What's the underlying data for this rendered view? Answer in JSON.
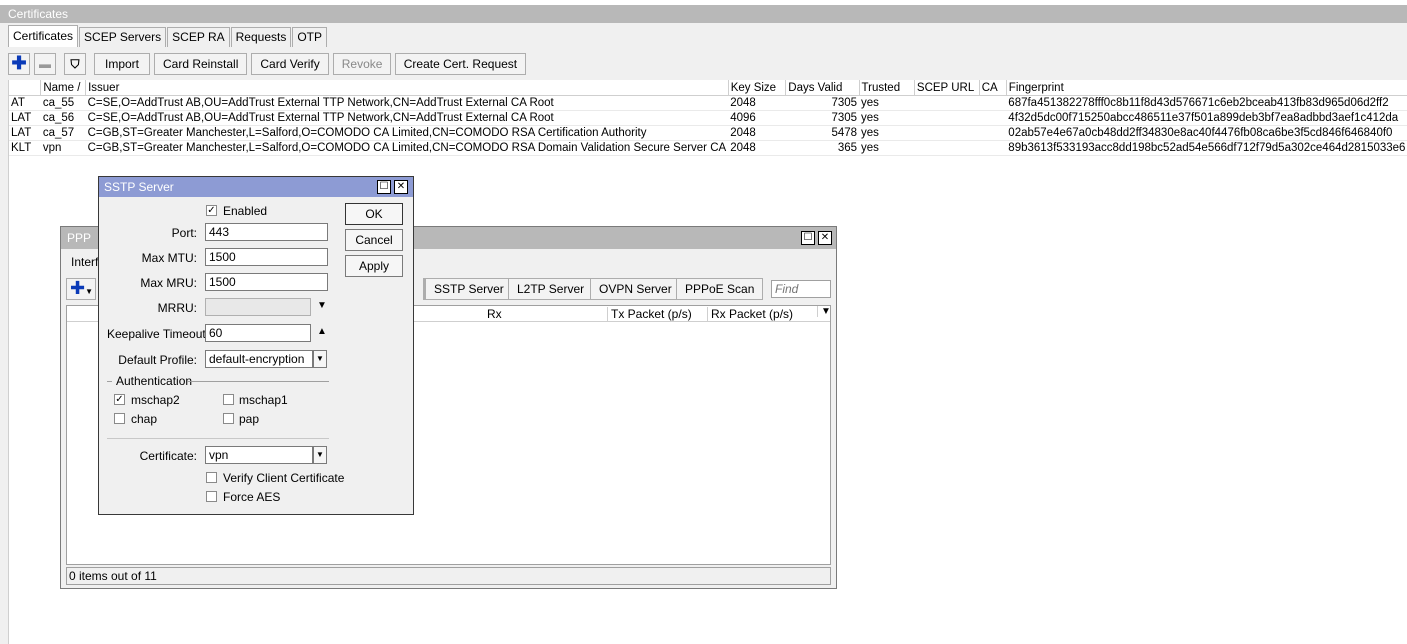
{
  "cert_window": {
    "title": "Certificates",
    "tabs": [
      "Certificates",
      "SCEP Servers",
      "SCEP RA",
      "Requests",
      "OTP"
    ],
    "toolbar": {
      "import": "Import",
      "card_reinstall": "Card Reinstall",
      "card_verify": "Card Verify",
      "revoke": "Revoke",
      "create_request": "Create Cert. Request"
    },
    "columns": [
      "",
      "Name",
      "Issuer",
      "Key Size",
      "Days Valid",
      "Trusted",
      "SCEP URL",
      "CA",
      "Fingerprint"
    ],
    "rows": [
      {
        "flags": "AT",
        "name": "ca_55",
        "issuer": "C=SE,O=AddTrust AB,OU=AddTrust External TTP Network,CN=AddTrust External CA Root",
        "key_size": "2048",
        "days": "7305",
        "trusted": "yes",
        "fingerprint": "687fa451382278fff0c8b11f8d43d576671c6eb2bceab413fb83d965d06d2ff2"
      },
      {
        "flags": "LAT",
        "name": "ca_56",
        "issuer": "C=SE,O=AddTrust AB,OU=AddTrust External TTP Network,CN=AddTrust External CA Root",
        "key_size": "4096",
        "days": "7305",
        "trusted": "yes",
        "fingerprint": "4f32d5dc00f715250abcc486511e37f501a899deb3bf7ea8adbbd3aef1c412da"
      },
      {
        "flags": "LAT",
        "name": "ca_57",
        "issuer": "C=GB,ST=Greater Manchester,L=Salford,O=COMODO CA Limited,CN=COMODO RSA Certification Authority",
        "key_size": "2048",
        "days": "5478",
        "trusted": "yes",
        "fingerprint": "02ab57e4e67a0cb48dd2ff34830e8ac40f4476fb08ca6be3f5cd846f646840f0"
      },
      {
        "flags": "KLT",
        "name": "vpn",
        "issuer": "C=GB,ST=Greater Manchester,L=Salford,O=COMODO CA Limited,CN=COMODO RSA Domain Validation Secure Server CA",
        "key_size": "2048",
        "days": "365",
        "trusted": "yes",
        "fingerprint": "89b3613f533193acc8dd198bc52ad54e566df712f79d5a302ce464d2815033e6"
      }
    ]
  },
  "ppp_window": {
    "title": "PPP",
    "tab_partial": "Interfa",
    "buttons": {
      "sstp": "SSTP Server",
      "l2tp": "L2TP Server",
      "ovpn": "OVPN Server",
      "pppoe_scan": "PPPoE Scan"
    },
    "find_placeholder": "Find",
    "columns": [
      "Rx",
      "Tx Packet (p/s)",
      "Rx Packet (p/s)"
    ],
    "status": "0 items out of 11"
  },
  "sstp_dialog": {
    "title": "SSTP Server",
    "enabled_label": "Enabled",
    "port_label": "Port:",
    "port": "443",
    "max_mtu_label": "Max MTU:",
    "max_mtu": "1500",
    "max_mru_label": "Max MRU:",
    "max_mru": "1500",
    "mrru_label": "MRRU:",
    "keepalive_label": "Keepalive Timeout:",
    "keepalive": "60",
    "profile_label": "Default Profile:",
    "profile": "default-encryption",
    "auth_section": "Authentication",
    "mschap2": "mschap2",
    "mschap1": "mschap1",
    "chap": "chap",
    "pap": "pap",
    "certificate_label": "Certificate:",
    "certificate": "vpn",
    "verify_client": "Verify Client Certificate",
    "force_aes": "Force AES",
    "ok": "OK",
    "cancel": "Cancel",
    "apply": "Apply"
  }
}
